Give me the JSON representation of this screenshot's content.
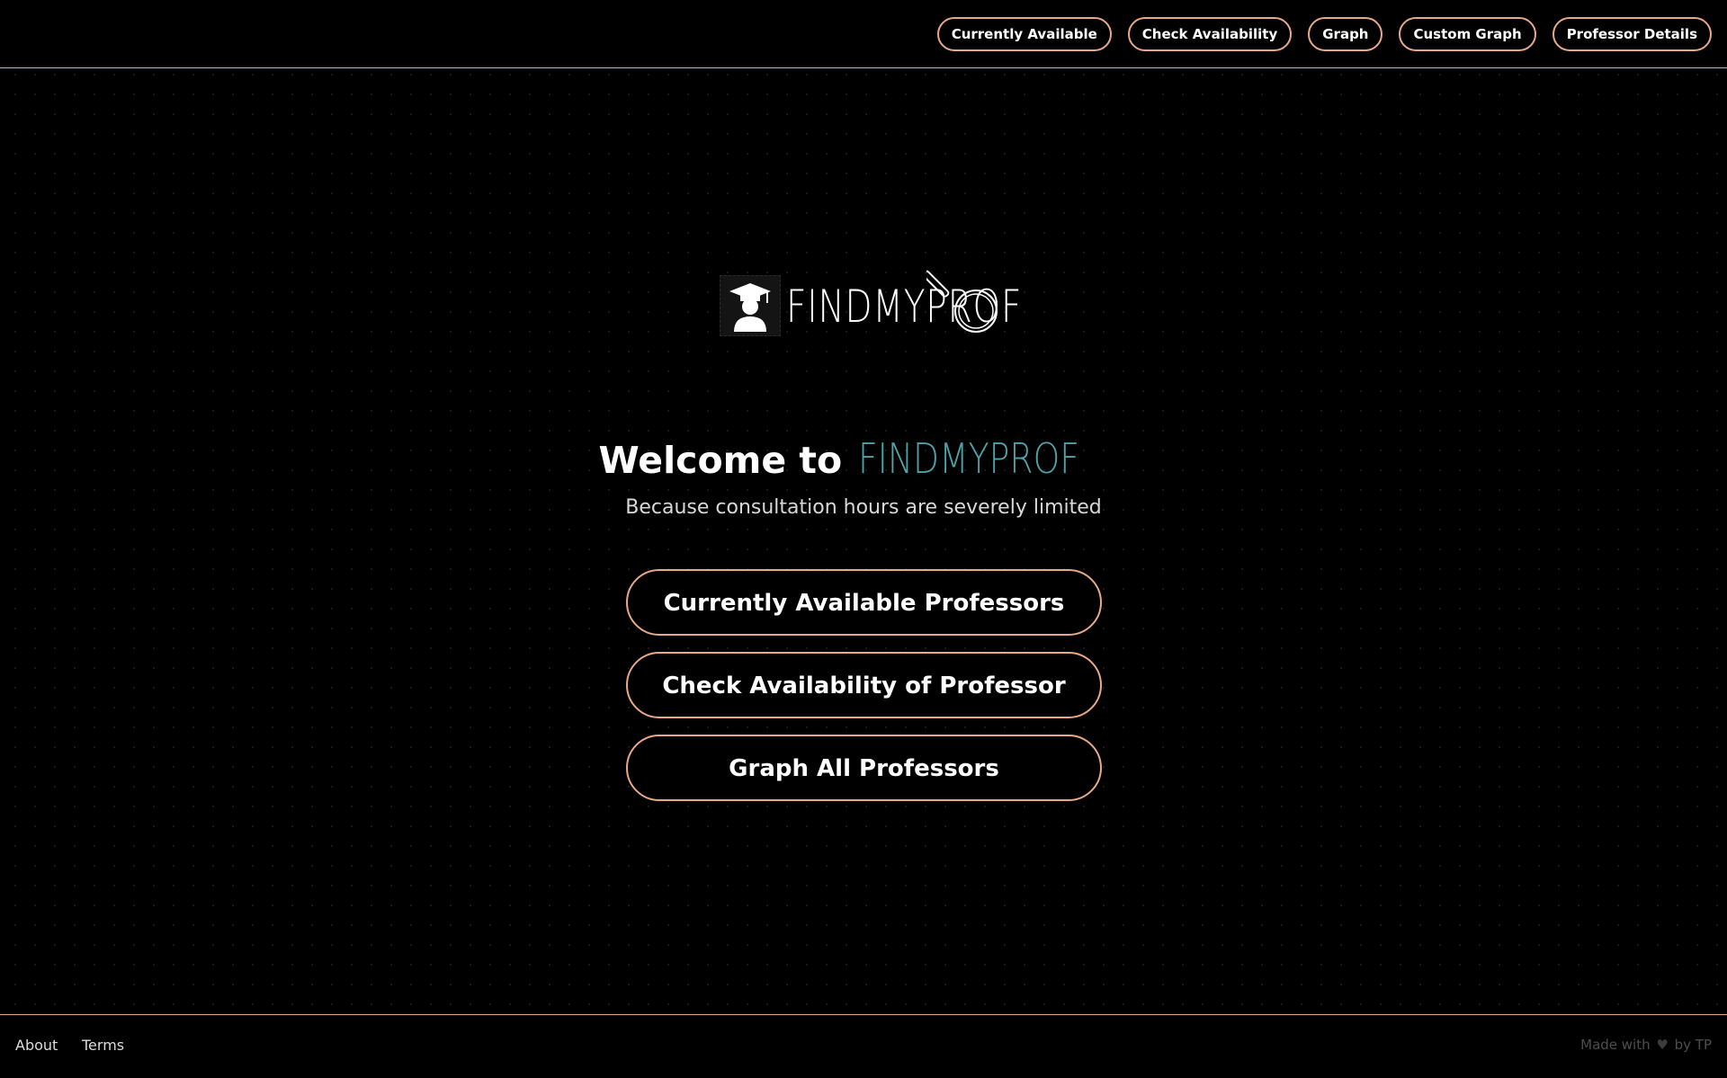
{
  "nav": {
    "buttons": [
      {
        "label": "Currently Available"
      },
      {
        "label": "Check Availability"
      },
      {
        "label": "Graph"
      },
      {
        "label": "Custom Graph"
      },
      {
        "label": "Professor Details"
      }
    ]
  },
  "logo": {
    "wordmark": "FINDMYPROF",
    "icon": "graduate-cap-icon"
  },
  "hero": {
    "welcome_prefix": "Welcome to",
    "welcome_brand": "FINDMYPROF",
    "tagline": "Because consultation hours are severely limited"
  },
  "actions": [
    {
      "label": "Currently Available Professors"
    },
    {
      "label": "Check Availability of Professor"
    },
    {
      "label": "Graph All Professors"
    }
  ],
  "footer": {
    "about": "About",
    "terms": "Terms",
    "credit_prefix": "Made with",
    "credit_heart": "♥",
    "credit_suffix": "by TP"
  },
  "colors": {
    "accent": "#e7a98a",
    "brand_teal": "#4fa3a8",
    "background": "#000000"
  }
}
